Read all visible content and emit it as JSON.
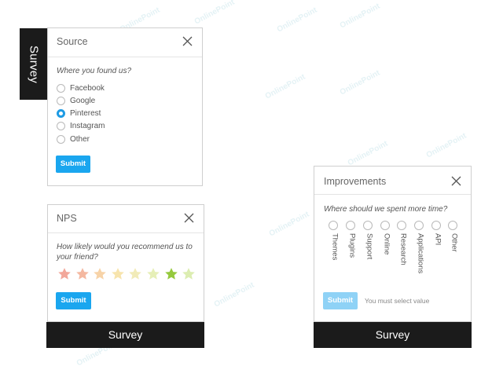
{
  "side_tab": {
    "label": "Survey"
  },
  "source_card": {
    "title": "Source",
    "question": "Where you found us?",
    "options": [
      "Facebook",
      "Google",
      "Pinterest",
      "Instagram",
      "Other"
    ],
    "selected": "Pinterest",
    "submit_label": "Submit"
  },
  "nps_card": {
    "title": "NPS",
    "question_line1": "How likely would you recommend us to",
    "question_line2": "your friend?",
    "rating_scale": 8,
    "selected_rating": 7,
    "star_colors": [
      "#f2a79a",
      "#f4b8a0",
      "#f7d3a8",
      "#f7e4ad",
      "#f1ebb8",
      "#e6efb7",
      "#95c93d",
      "#dcedb1"
    ],
    "submit_label": "Submit",
    "footer_label": "Survey"
  },
  "improvements_card": {
    "title": "Improvements",
    "question": "Where should we spent more time?",
    "options": [
      "Themes",
      "Plugins",
      "Support",
      "Online",
      "Research",
      "Applications",
      "API",
      "Other"
    ],
    "submit_label": "Submit",
    "error_text": "You must select value",
    "footer_label": "Survey"
  },
  "watermark": "OnlinePoint",
  "colors": {
    "accent": "#1aa6ef",
    "dark": "#1b1b1b"
  }
}
